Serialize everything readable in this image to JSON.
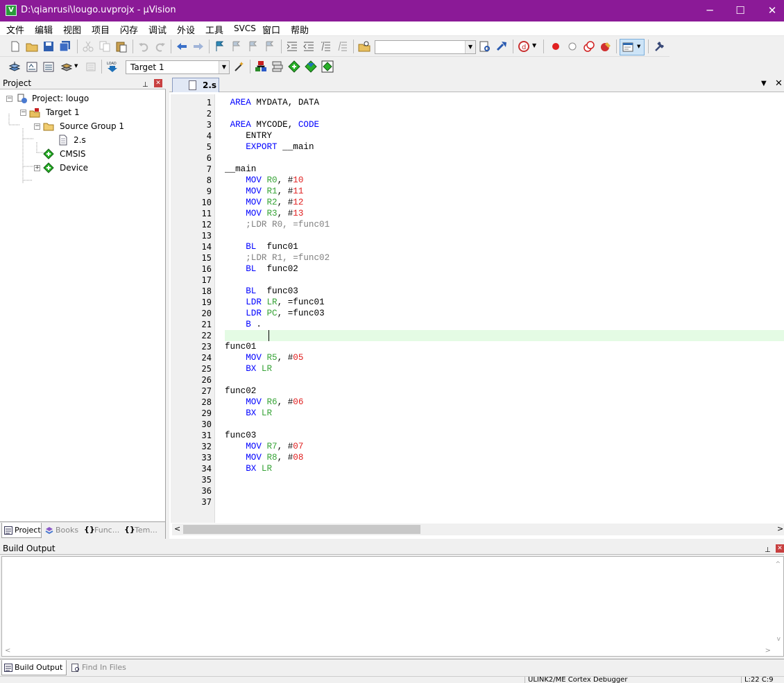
{
  "window": {
    "title": "D:\\qianrusi\\lougo.uvprojx - μVision",
    "minimize": "─",
    "maximize": "☐",
    "close": "✕"
  },
  "menu": [
    "文件",
    "编辑",
    "视图",
    "项目",
    "闪存",
    "调试",
    "外设",
    "工具",
    "SVCS",
    "窗口",
    "帮助"
  ],
  "toolbar2": {
    "target_value": "Target 1"
  },
  "project_panel": {
    "title": "Project",
    "tree": {
      "project": "Project: lougo",
      "target": "Target 1",
      "group": "Source Group 1",
      "file": "2.s",
      "cmsis": "CMSIS",
      "device": "Device"
    },
    "tabs": [
      "Project",
      "Books",
      "Func...",
      "Tem..."
    ]
  },
  "editor": {
    "tab": "2.s",
    "line_numbers": [
      "1",
      "2",
      "3",
      "4",
      "5",
      "6",
      "7",
      "8",
      "9",
      "10",
      "11",
      "12",
      "13",
      "14",
      "15",
      "16",
      "17",
      "18",
      "19",
      "20",
      "21",
      "22",
      "23",
      "24",
      "25",
      "26",
      "27",
      "28",
      "29",
      "30",
      "31",
      "32",
      "33",
      "34",
      "35",
      "36",
      "37"
    ],
    "lines": [
      [
        {
          "t": " "
        },
        {
          "t": "AREA",
          "c": "kw"
        },
        {
          "t": " MYDATA, DATA"
        }
      ],
      [],
      [
        {
          "t": " "
        },
        {
          "t": "AREA",
          "c": "kw"
        },
        {
          "t": " MYCODE, "
        },
        {
          "t": "CODE",
          "c": "kw"
        }
      ],
      [
        {
          "t": "    ENTRY"
        }
      ],
      [
        {
          "t": "    "
        },
        {
          "t": "EXPORT",
          "c": "kw"
        },
        {
          "t": " __main"
        }
      ],
      [],
      [
        {
          "t": "__main"
        }
      ],
      [
        {
          "t": "    "
        },
        {
          "t": "MOV",
          "c": "kw"
        },
        {
          "t": " "
        },
        {
          "t": "R0",
          "c": "reg"
        },
        {
          "t": ", #"
        },
        {
          "t": "10",
          "c": "num"
        }
      ],
      [
        {
          "t": "    "
        },
        {
          "t": "MOV",
          "c": "kw"
        },
        {
          "t": " "
        },
        {
          "t": "R1",
          "c": "reg"
        },
        {
          "t": ", #"
        },
        {
          "t": "11",
          "c": "num"
        }
      ],
      [
        {
          "t": "    "
        },
        {
          "t": "MOV",
          "c": "kw"
        },
        {
          "t": " "
        },
        {
          "t": "R2",
          "c": "reg"
        },
        {
          "t": ", #"
        },
        {
          "t": "12",
          "c": "num"
        }
      ],
      [
        {
          "t": "    "
        },
        {
          "t": "MOV",
          "c": "kw"
        },
        {
          "t": " "
        },
        {
          "t": "R3",
          "c": "reg"
        },
        {
          "t": ", #"
        },
        {
          "t": "13",
          "c": "num"
        }
      ],
      [
        {
          "t": "    ;LDR R0, =func01",
          "c": "cmt"
        }
      ],
      [],
      [
        {
          "t": "    "
        },
        {
          "t": "BL",
          "c": "kw"
        },
        {
          "t": "  func01"
        }
      ],
      [
        {
          "t": "    ;LDR R1, =func02",
          "c": "cmt"
        }
      ],
      [
        {
          "t": "    "
        },
        {
          "t": "BL",
          "c": "kw"
        },
        {
          "t": "  func02"
        }
      ],
      [],
      [
        {
          "t": "    "
        },
        {
          "t": "BL",
          "c": "kw"
        },
        {
          "t": "  func03"
        }
      ],
      [
        {
          "t": "    "
        },
        {
          "t": "LDR",
          "c": "kw"
        },
        {
          "t": " "
        },
        {
          "t": "LR",
          "c": "reg"
        },
        {
          "t": ", =func01"
        }
      ],
      [
        {
          "t": "    "
        },
        {
          "t": "LDR",
          "c": "kw"
        },
        {
          "t": " "
        },
        {
          "t": "PC",
          "c": "reg"
        },
        {
          "t": ", =func03"
        }
      ],
      [
        {
          "t": "    "
        },
        {
          "t": "B",
          "c": "kw"
        },
        {
          "t": " ."
        }
      ],
      [],
      [
        {
          "t": "func01"
        }
      ],
      [
        {
          "t": "    "
        },
        {
          "t": "MOV",
          "c": "kw"
        },
        {
          "t": " "
        },
        {
          "t": "R5",
          "c": "reg"
        },
        {
          "t": ", #"
        },
        {
          "t": "05",
          "c": "num"
        }
      ],
      [
        {
          "t": "    "
        },
        {
          "t": "BX",
          "c": "kw"
        },
        {
          "t": " "
        },
        {
          "t": "LR",
          "c": "reg"
        }
      ],
      [],
      [
        {
          "t": "func02"
        }
      ],
      [
        {
          "t": "    "
        },
        {
          "t": "MOV",
          "c": "kw"
        },
        {
          "t": " "
        },
        {
          "t": "R6",
          "c": "reg"
        },
        {
          "t": ", #"
        },
        {
          "t": "06",
          "c": "num"
        }
      ],
      [
        {
          "t": "    "
        },
        {
          "t": "BX",
          "c": "kw"
        },
        {
          "t": " "
        },
        {
          "t": "LR",
          "c": "reg"
        }
      ],
      [],
      [
        {
          "t": "func03"
        }
      ],
      [
        {
          "t": "    "
        },
        {
          "t": "MOV",
          "c": "kw"
        },
        {
          "t": " "
        },
        {
          "t": "R7",
          "c": "reg"
        },
        {
          "t": ", #"
        },
        {
          "t": "07",
          "c": "num"
        }
      ],
      [
        {
          "t": "    "
        },
        {
          "t": "MOV",
          "c": "kw"
        },
        {
          "t": " "
        },
        {
          "t": "R8",
          "c": "reg"
        },
        {
          "t": ", #"
        },
        {
          "t": "08",
          "c": "num"
        }
      ],
      [
        {
          "t": "    "
        },
        {
          "t": "BX",
          "c": "kw"
        },
        {
          "t": " "
        },
        {
          "t": "LR",
          "c": "reg"
        }
      ],
      [],
      [],
      []
    ],
    "current_line": 22
  },
  "build_output": {
    "title": "Build Output",
    "tabs": [
      "Build Output",
      "Find In Files"
    ]
  },
  "status": {
    "debugger": "ULINK2/ME Cortex Debugger",
    "position": "L:22 C:9"
  },
  "colors": {
    "titlebar": "#8b1a97",
    "keyword": "#0000ff",
    "register": "#36a336",
    "number": "#e02020",
    "comment": "#808080",
    "current_line": "#e4fbe4"
  }
}
